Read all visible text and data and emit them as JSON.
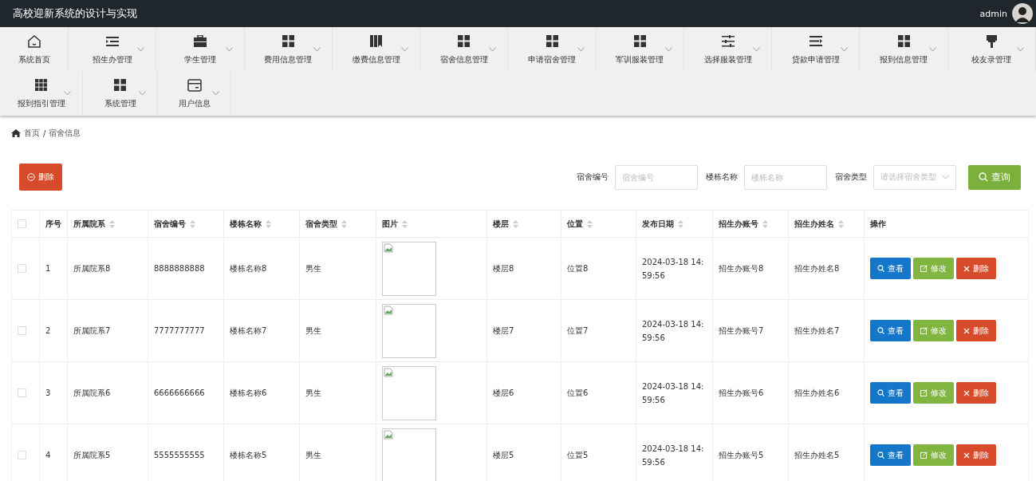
{
  "header": {
    "title": "高校迎新系统的设计与实现",
    "user": "admin"
  },
  "nav": [
    [
      {
        "label": "系统首页",
        "dropdown": false
      },
      {
        "label": "招生办管理",
        "dropdown": true
      },
      {
        "label": "学生管理",
        "dropdown": true
      },
      {
        "label": "费用信息管理",
        "dropdown": true
      },
      {
        "label": "缴费信息管理",
        "dropdown": true
      },
      {
        "label": "宿舍信息管理",
        "dropdown": true
      },
      {
        "label": "申请宿舍管理",
        "dropdown": true
      },
      {
        "label": "军训服装管理",
        "dropdown": true
      },
      {
        "label": "选择服装管理",
        "dropdown": true
      },
      {
        "label": "贷款申请管理",
        "dropdown": true
      },
      {
        "label": "报到信息管理",
        "dropdown": true
      },
      {
        "label": "校友录管理",
        "dropdown": true
      }
    ],
    [
      {
        "label": "报到指引管理",
        "dropdown": true
      },
      {
        "label": "系统管理",
        "dropdown": true
      },
      {
        "label": "用户信息",
        "dropdown": true
      }
    ]
  ],
  "breadcrumb": {
    "home": "首页",
    "separator": "/",
    "current": "宿舍信息"
  },
  "delete_button": "删除",
  "filters": [
    {
      "label": "宿舍编号",
      "placeholder": "宿舍编号",
      "kind": "text"
    },
    {
      "label": "楼栋名称",
      "placeholder": "楼栋名称",
      "kind": "text"
    },
    {
      "label": "宿舍类型",
      "placeholder": "请选择宿舍类型",
      "kind": "select"
    }
  ],
  "search_button": "查询",
  "table": {
    "header_checked": false,
    "columns": [
      {
        "label": "序号",
        "sortable": false
      },
      {
        "label": "所属院系",
        "sortable": true
      },
      {
        "label": "宿舍编号",
        "sortable": true
      },
      {
        "label": "楼栋名称",
        "sortable": true
      },
      {
        "label": "宿舍类型",
        "sortable": true
      },
      {
        "label": "图片",
        "sortable": true
      },
      {
        "label": "楼层",
        "sortable": true
      },
      {
        "label": "位置",
        "sortable": true
      },
      {
        "label": "发布日期",
        "sortable": true
      },
      {
        "label": "招生办账号",
        "sortable": true
      },
      {
        "label": "招生办姓名",
        "sortable": true
      },
      {
        "label": "操作",
        "sortable": false
      }
    ],
    "rows": [
      {
        "checked": false,
        "cells": [
          "1",
          "所属院系8",
          "8888888888",
          "楼栋名称8",
          "男生",
          "",
          "楼层8",
          "位置8",
          "2024-03-18 14:59:56",
          "招生办账号8",
          "招生办姓名8"
        ],
        "actions": [
          "查看",
          "修改",
          "删除"
        ]
      },
      {
        "checked": false,
        "cells": [
          "2",
          "所属院系7",
          "7777777777",
          "楼栋名称7",
          "男生",
          "",
          "楼层7",
          "位置7",
          "2024-03-18 14:59:56",
          "招生办账号7",
          "招生办姓名7"
        ],
        "actions": [
          "查看",
          "修改",
          "删除"
        ]
      },
      {
        "checked": false,
        "cells": [
          "3",
          "所属院系6",
          "6666666666",
          "楼栋名称6",
          "男生",
          "",
          "楼层6",
          "位置6",
          "2024-03-18 14:59:56",
          "招生办账号6",
          "招生办姓名6"
        ],
        "actions": [
          "查看",
          "修改",
          "删除"
        ]
      },
      {
        "checked": false,
        "cells": [
          "4",
          "所属院系5",
          "5555555555",
          "楼栋名称5",
          "男生",
          "",
          "楼层5",
          "位置5",
          "2024-03-18 14:59:56",
          "招生办账号5",
          "招生办姓名5"
        ],
        "actions": [
          "查看",
          "修改",
          "删除"
        ]
      }
    ]
  }
}
